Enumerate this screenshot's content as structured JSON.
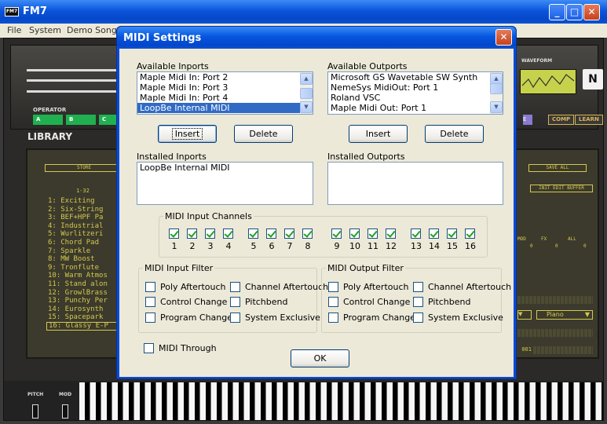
{
  "window": {
    "title": "FM7",
    "icon_text": "FM7",
    "minimize": "_",
    "maximize": "□",
    "close": "✕"
  },
  "menu": [
    "File",
    "System",
    "Demo Song"
  ],
  "synth": {
    "operator_label": "OPERATOR",
    "operators": [
      "A",
      "B",
      "C"
    ],
    "waveform_label": "WAVEFORM",
    "ni_logo": "N",
    "buttons": {
      "e": "E",
      "comp": "COMP",
      "learn": "LEARN"
    },
    "library_title": "LIBRARY",
    "store": "STORE",
    "save_all": "SAVE ALL",
    "init_edit_buffer": "INIT EDIT BUFFER",
    "range": "1-32",
    "mod_labels": [
      "MOD",
      "FX",
      "ALL"
    ],
    "mod_values": [
      "0",
      "0",
      "0"
    ],
    "presets": [
      "1: Exciting",
      "2: Six-String",
      "3: BEF+HPF Pa",
      "4: Industrial",
      "5: Wurlitzeri",
      "6: Chord Pad",
      "7: Sparkle",
      "8: MW Boost",
      "9: Tronflute",
      "10: Warm Atmos",
      "11: Stand alon",
      "12: GrowlBrass",
      "13: Punchy Per",
      "14: Eurosynth",
      "15: Spacepark",
      "16: Glassy E-P"
    ],
    "selected_preset_index": 15,
    "instrument_value": "Piano",
    "number_readout": "001",
    "pitch_label": "PITCH",
    "mod_label": "MOD"
  },
  "dialog": {
    "title": "MIDI Settings",
    "close": "✕",
    "available_inports_label": "Available Inports",
    "available_inports": [
      "Maple Midi In: Port 2",
      "Maple Midi In: Port 3",
      "Maple Midi In: Port 4",
      "LoopBe Internal MIDI"
    ],
    "available_inports_selected": 3,
    "available_outports_label": "Available Outports",
    "available_outports": [
      "Microsoft GS Wavetable SW Synth",
      "NemeSys MidiOut: Port 1",
      "Roland VSC",
      "Maple Midi Out: Port 1"
    ],
    "insert_label": "Insert",
    "delete_label": "Delete",
    "installed_inports_label": "Installed Inports",
    "installed_inports": [
      "LoopBe Internal MIDI"
    ],
    "installed_outports_label": "Installed Outports",
    "installed_outports": [],
    "channels_label": "MIDI Input Channels",
    "channels": [
      {
        "n": "1",
        "checked": true
      },
      {
        "n": "2",
        "checked": true
      },
      {
        "n": "3",
        "checked": true
      },
      {
        "n": "4",
        "checked": true
      },
      {
        "n": "5",
        "checked": true
      },
      {
        "n": "6",
        "checked": true
      },
      {
        "n": "7",
        "checked": true
      },
      {
        "n": "8",
        "checked": true
      },
      {
        "n": "9",
        "checked": true
      },
      {
        "n": "10",
        "checked": true
      },
      {
        "n": "11",
        "checked": true
      },
      {
        "n": "12",
        "checked": true
      },
      {
        "n": "13",
        "checked": true
      },
      {
        "n": "14",
        "checked": true
      },
      {
        "n": "15",
        "checked": true
      },
      {
        "n": "16",
        "checked": true
      }
    ],
    "input_filter": {
      "label": "MIDI Input Filter",
      "poly_aftertouch": "Poly Aftertouch",
      "channel_aftertouch": "Channel Aftertouch",
      "control_change": "Control Change",
      "pitchbend": "Pitchbend",
      "program_change": "Program Change",
      "system_exclusive": "System Exclusive"
    },
    "output_filter": {
      "label": "MIDI Output Filter",
      "poly_aftertouch": "Poly Aftertouch",
      "channel_aftertouch": "Channel Aftertouch",
      "control_change": "Control Change",
      "pitchbend": "Pitchbend",
      "program_change": "Program Change",
      "system_exclusive": "System Exclusive"
    },
    "midi_through": "MIDI Through",
    "ok_label": "OK"
  },
  "colors": {
    "xp_blue": "#0a55dc",
    "dialog_face": "#ece9d8",
    "list_selection": "#316ac5",
    "lcd_text": "#d4c94e",
    "check_green": "#21a121"
  }
}
